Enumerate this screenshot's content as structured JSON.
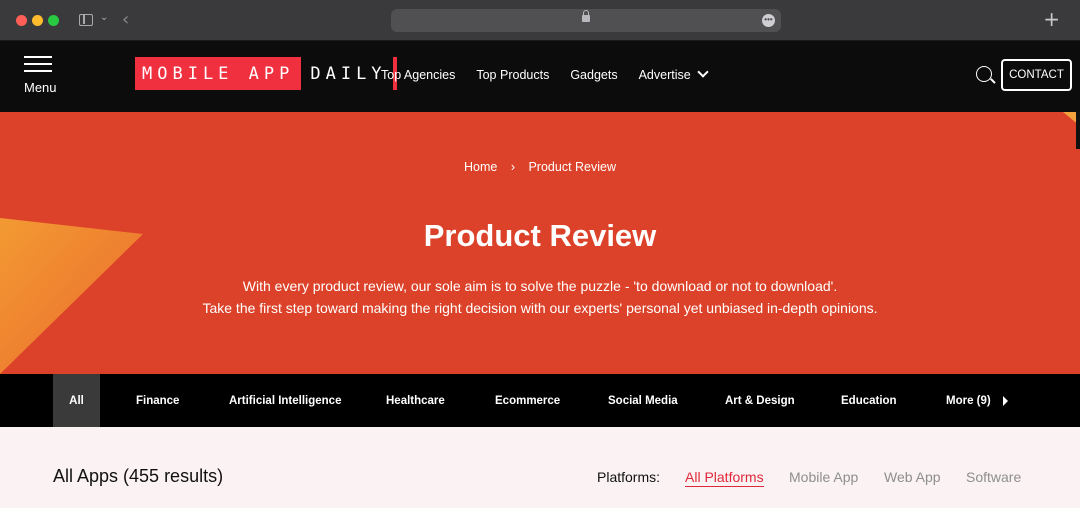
{
  "browser": {
    "new_tab_label": "+",
    "back_label": "‹"
  },
  "header": {
    "menu_label": "Menu",
    "logo_part1": "MOBILE APP",
    "logo_part2": "DAILY",
    "nav": [
      {
        "label": "Top Agencies"
      },
      {
        "label": "Top Products"
      },
      {
        "label": "Gadgets"
      },
      {
        "label": "Advertise"
      }
    ],
    "contact_label": "CONTACT"
  },
  "hero": {
    "breadcrumb_home": "Home",
    "breadcrumb_sep": "›",
    "breadcrumb_current": "Product Review",
    "title": "Product Review",
    "subtitle_line1": "With every product review, our sole aim is to solve the puzzle - 'to download or not to download'.",
    "subtitle_line2": "Take the first step toward making the right decision with our experts' personal yet unbiased in-depth opinions."
  },
  "categories": [
    {
      "label": "All"
    },
    {
      "label": "Finance"
    },
    {
      "label": "Artificial Intelligence"
    },
    {
      "label": "Healthcare"
    },
    {
      "label": "Ecommerce"
    },
    {
      "label": "Social Media"
    },
    {
      "label": "Art & Design"
    },
    {
      "label": "Education"
    },
    {
      "label": "More (9)"
    }
  ],
  "listing": {
    "results_title": "All Apps (455 results)",
    "platforms_label": "Platforms:",
    "platforms": [
      {
        "label": "All Platforms"
      },
      {
        "label": "Mobile App"
      },
      {
        "label": "Web App"
      },
      {
        "label": "Software"
      }
    ]
  },
  "colors": {
    "hero_bg": "#dc4229",
    "brand_red": "#f0303f",
    "active_platform": "#e0283a"
  }
}
